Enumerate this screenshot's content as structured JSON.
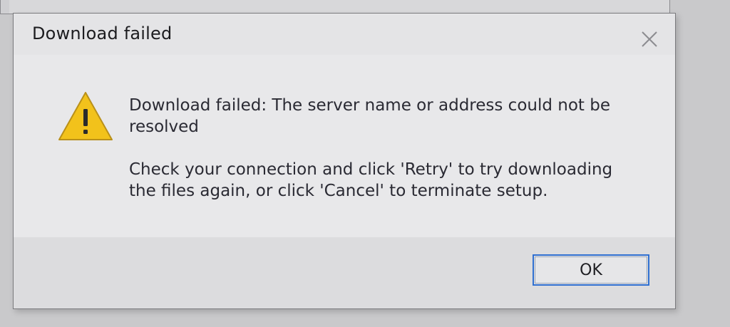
{
  "dialog": {
    "title": "Download failed",
    "close_icon": "close-icon",
    "warning_icon": "warning-triangle-icon",
    "main_message": "Download failed: The server name or address could not be resolved",
    "sub_message": "Check your connection and click 'Retry' to try downloading the files again, or click 'Cancel' to terminate setup.",
    "ok_label": "OK",
    "colors": {
      "warning_fill": "#f2c21b",
      "ok_border": "#2f6fd0",
      "text": "#2a2a33"
    }
  }
}
